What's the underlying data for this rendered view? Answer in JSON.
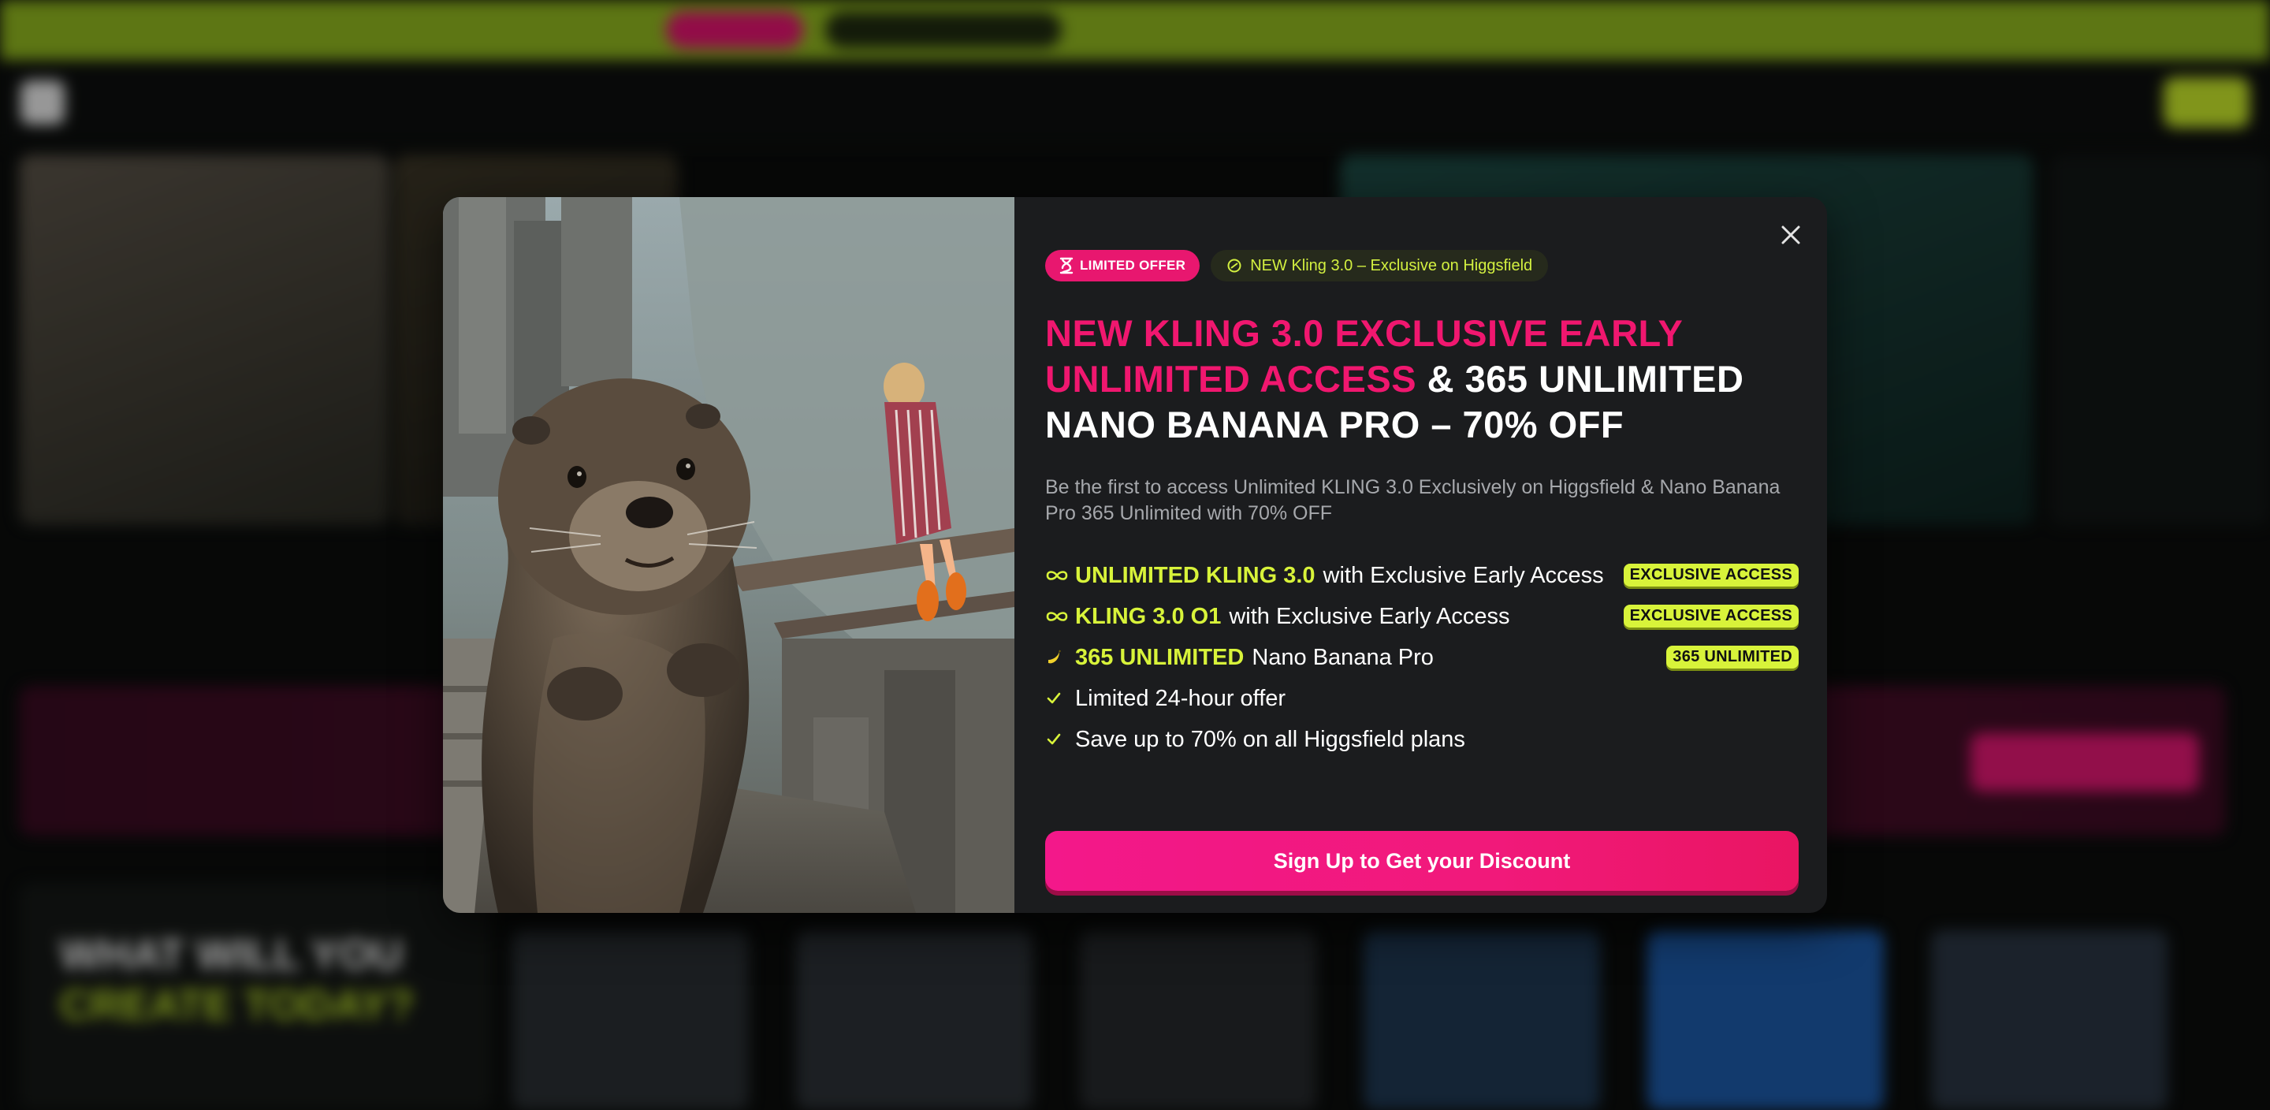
{
  "modal": {
    "badge_limited": "LIMITED OFFER",
    "badge_new": "NEW Kling 3.0 – Exclusive on Higgsfield",
    "headline_pink": "NEW KLING 3.0 EXCLUSIVE EARLY UNLIMITED ACCESS",
    "headline_white": " & 365 UNLIMITED NANO BANANA PRO – 70% OFF",
    "subtext": "Be the first to access Unlimited KLING 3.0 Exclusively on Higgsfield & Nano Banana Pro 365 Unlimited with 70% OFF",
    "features": [
      {
        "icon": "infinity-icon",
        "highlight": "UNLIMITED KLING 3.0",
        "text": "with Exclusive Early Access",
        "tag": "EXCLUSIVE ACCESS"
      },
      {
        "icon": "infinity-icon",
        "highlight": "KLING 3.0 O1",
        "text": "with Exclusive Early Access",
        "tag": "EXCLUSIVE ACCESS"
      },
      {
        "icon": "banana-icon",
        "highlight": "365 UNLIMITED",
        "text": "Nano Banana Pro",
        "tag": "365 UNLIMITED"
      },
      {
        "icon": "check-icon",
        "highlight": "",
        "text": "Limited 24-hour offer",
        "tag": ""
      },
      {
        "icon": "check-icon",
        "highlight": "",
        "text": "Save up to 70% on all Higgsfield plans",
        "tag": ""
      }
    ],
    "cta_label": "Sign Up to Get your Discount",
    "image_alt": "Giant otter on a skyscraper rooftop with a woman floating in the air"
  },
  "colors": {
    "accent_pink": "#f0176f",
    "accent_lime": "#d8f33a",
    "modal_bg": "#1b1c1e"
  },
  "background": {
    "create_title_1": "WHAT WILL YOU",
    "create_title_2": "CREATE TODAY?"
  }
}
